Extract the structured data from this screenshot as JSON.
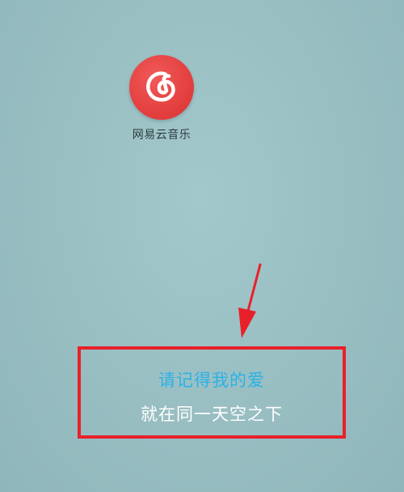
{
  "home_screen": {
    "apps": [
      {
        "label": "网易云音乐",
        "icon": "netease-cloud-music-icon",
        "color": "#e23c3c"
      }
    ]
  },
  "desktop_lyrics": {
    "line1": "请记得我的爱",
    "line2": "就在同一天空之下",
    "line1_color": "#2ab2e6",
    "line2_color": "#ffffff"
  },
  "annotation": {
    "highlight_color": "#e8202a",
    "arrow_color": "#e8202a"
  }
}
